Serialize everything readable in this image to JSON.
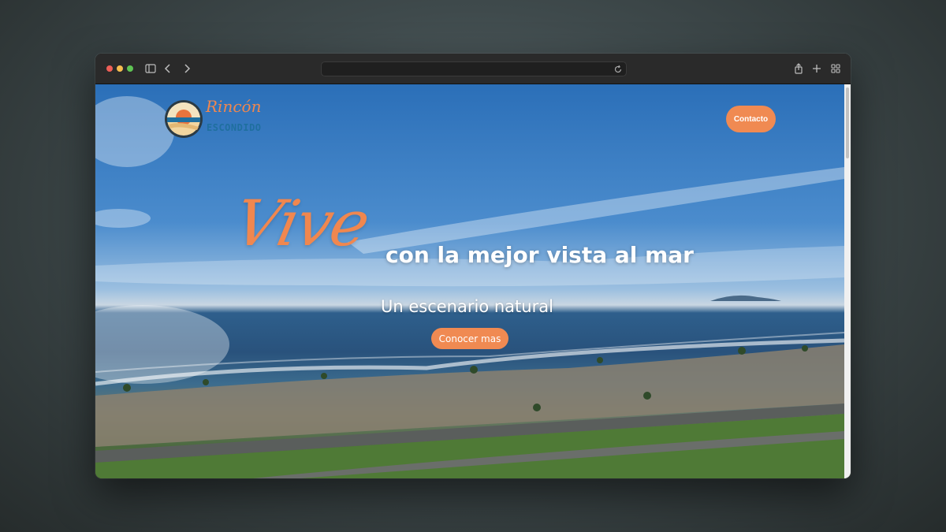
{
  "browser": {
    "url": "",
    "icons": [
      "sidebar-icon",
      "back-icon",
      "forward-icon",
      "reload-icon",
      "share-icon",
      "new-tab-icon",
      "tab-overview-icon"
    ]
  },
  "site": {
    "logo": {
      "script": "Rincón",
      "word": "ESCONDIDO"
    },
    "nav": {
      "contact_label": "Contacto"
    },
    "hero": {
      "accent": "Vive",
      "headline": "con la mejor vista al mar",
      "subtitle": "Un escenario natural",
      "cta_label": "Conocer mas"
    }
  },
  "colors": {
    "accent": "#f08a52",
    "logo_blue": "#1f6f9f",
    "traffic_red": "#ee5f57",
    "traffic_yellow": "#f5bd4f",
    "traffic_green": "#5fc454"
  }
}
